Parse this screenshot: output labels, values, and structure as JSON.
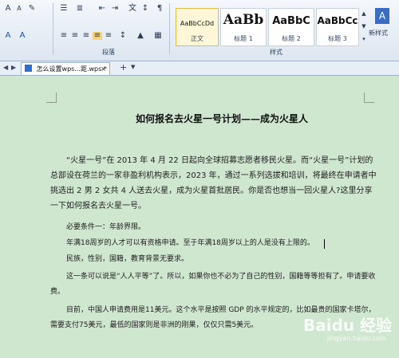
{
  "ribbon": {
    "para_group_label": "段落",
    "style_group_label": "样式",
    "styles": [
      {
        "sample": "AaBbCcDd",
        "name": "正文"
      },
      {
        "sample": "AaBb",
        "name": "标题 1"
      },
      {
        "sample": "AaBbC",
        "name": "标题 2"
      },
      {
        "sample": "AaBbCc",
        "name": "标题 3"
      }
    ],
    "new_style_label": "新样式"
  },
  "tabs": {
    "doc_tab": "怎么设置wps...距.wps *",
    "close": "×",
    "add": "+"
  },
  "document": {
    "title": "如何报名去火星一号计划——成为火星人",
    "p1": "“火星一号”在 2013 年 4 月 22 日起向全球招募志愿者移民火星。而“火星一号”计划的总部设在荷兰的一家非盈利机构表示，2023 年，通过一系列选拔和培训，将最终在申请者中挑选出 2 男 2 女共 4 人送去火星，成为火星首批居民。你是否也想当一回火星人?这里分享一下如何报名去火星一号。",
    "p2": "必要条件一：年龄界限。",
    "p3": "年满18周岁的人才可以有资格申请。至于年满18周岁以上的人是没有上限的。",
    "p4": "民族，性别，国籍，教育背景无要求。",
    "p5": "这一条可以说是“人人平等”了。所以，如果你也不必为了自己的性别，国籍等等担有了。申请要收费。",
    "p6": "目前，中国人申请费用是11美元。这个水平是按照 GDP 的水平规定的，比如最贵的国家卡塔尔，需要支付75美元，最低的国家则是非洲的刚果，仅仅只需5美元。"
  },
  "watermark": {
    "text": "Baidu 经验",
    "sub": "jingyan.baidu.com"
  }
}
